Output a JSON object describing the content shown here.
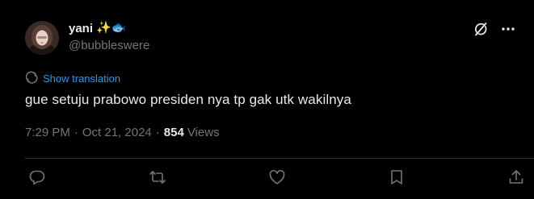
{
  "author": {
    "display_name": "yani",
    "name_emoji": "✨🐟",
    "handle": "@bubbleswere",
    "avatar": "avatar-photo"
  },
  "header_icons": [
    "grok-icon",
    "more-icon"
  ],
  "translation": {
    "label": "Show translation",
    "icon": "globe-icon"
  },
  "tweet": {
    "text": "gue setuju prabowo presiden nya tp gak utk wakilnya"
  },
  "meta": {
    "time": "7:29 PM",
    "date": "Oct 21, 2024",
    "separator": "·",
    "views_count": "854",
    "views_label": "Views"
  },
  "actions": [
    "reply-icon",
    "retweet-icon",
    "like-icon",
    "bookmark-icon",
    "share-icon"
  ],
  "colors": {
    "background": "#000000",
    "text": "#e7e9ea",
    "muted": "#71767b",
    "link": "#1d9bf0",
    "divider": "#2f3336"
  }
}
